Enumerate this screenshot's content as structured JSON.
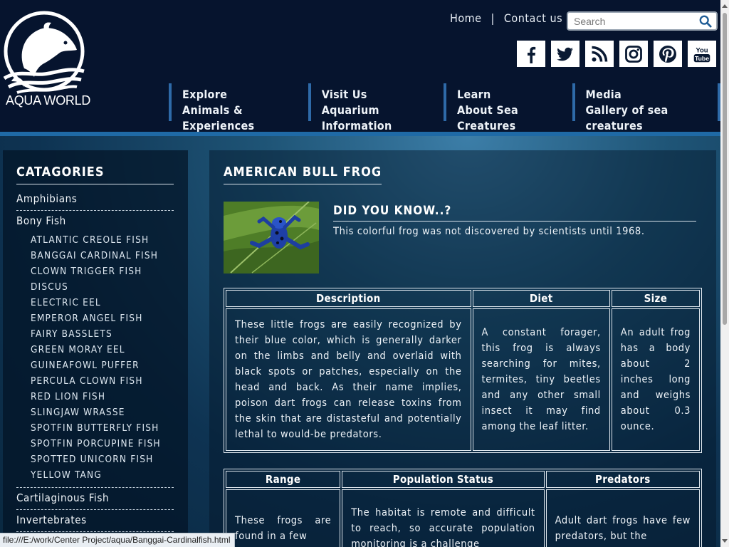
{
  "brand": {
    "name": "AQUA WORLD"
  },
  "toplinks": {
    "home": "Home",
    "separator": "|",
    "contact": "Contact us"
  },
  "search": {
    "placeholder": "Search"
  },
  "social": [
    "facebook-icon",
    "twitter-icon",
    "rss-icon",
    "instagram-icon",
    "pinterest-icon",
    "youtube-icon"
  ],
  "youtube": {
    "line1": "You",
    "line2": "Tube"
  },
  "nav": [
    {
      "title": "Explore",
      "subtitle": "Animals & Experiences"
    },
    {
      "title": "Visit Us",
      "subtitle": "Aquarium Information"
    },
    {
      "title": "Learn",
      "subtitle": "About Sea Creatures"
    },
    {
      "title": "Media",
      "subtitle": "Gallery of sea creatures"
    }
  ],
  "sidebar": {
    "heading": "CATAGORIES",
    "cat1": "Amphibians",
    "cat2": "Bony Fish",
    "bony_fish": [
      "ATLANTIC CREOLE FISH",
      "BANGGAI CARDINAL FISH",
      "CLOWN TRIGGER FISH",
      "DISCUS",
      "ELECTRIC EEL",
      "EMPEROR ANGEL FISH",
      "FAIRY BASSLETS",
      "GREEN MORAY EEL",
      "GUINEAFOWL PUFFER",
      "PERCULA CLOWN FISH",
      "RED LION FISH",
      "SLINGJAW WRASSE",
      "SPOTFIN BUTTERFLY FISH",
      "SPOTFIN PORCUPINE FISH",
      "SPOTTED UNICORN FISH",
      "YELLOW TANG"
    ],
    "cat3": "Cartilaginous Fish",
    "cat4": "Invertebrates"
  },
  "main": {
    "title": "AMERICAN BULL FROG",
    "did_you_know_heading": "DID YOU KNOW..?",
    "did_you_know_text": "This colorful frog was not discovered by scientists until 1968.",
    "table1": {
      "headers": [
        "Description",
        "Diet",
        "Size"
      ],
      "cells": [
        "These little frogs are easily recognized by their blue color, which is generally darker on the limbs and belly and overlaid with black spots or patches, especially on the head and back. As their name implies, poison dart frogs can release toxins from the skin that are distasteful and potentially lethal to would-be predators.",
        "A constant forager, this frog is always searching for mites, termites, tiny beetles and any other small insect it may find among the leaf litter.",
        "An adult frog has a body about 2 inches long and weighs about 0.3 ounce."
      ]
    },
    "table2": {
      "headers": [
        "Range",
        "Population Status",
        "Predators"
      ],
      "cells": [
        "These frogs are found in a few",
        "The habitat is remote and difficult to reach, so accurate population monitoring is a challenge",
        "Adult dart frogs have few predators, but the"
      ]
    }
  },
  "statusbar": {
    "url": "file:///E:/work/Center Project/aqua/Banggai-Cardinalfish.html"
  }
}
